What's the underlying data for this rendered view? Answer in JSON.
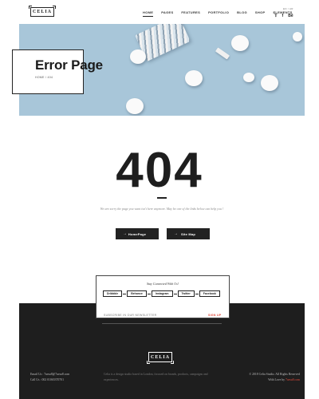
{
  "header": {
    "logo": "CELIA",
    "nav": [
      "HOME",
      "PAGES",
      "FEATURES",
      "PORTFOLIO",
      "BLOG",
      "SHOP",
      "ELEMENTS"
    ],
    "lang": "EN / AR",
    "social": [
      "twitter-icon",
      "facebook-icon",
      "behance-icon"
    ]
  },
  "hero": {
    "title": "Error Page",
    "breadcrumb": "HOME / 404"
  },
  "error": {
    "code": "404",
    "message": "We are sorry the page you want isn't here anymore. May be one of the links below can help you !",
    "buttons": [
      {
        "label": "HomePage",
        "icon": "arrow-right-icon"
      },
      {
        "label": "Site Map",
        "icon": "arrow-right-icon"
      }
    ]
  },
  "newsletter": {
    "title": "Stay Connected With Us!",
    "social_links": [
      "Dribbble",
      "Behance",
      "Instagram",
      "Twitter",
      "Facebook"
    ],
    "input_placeholder": "SUBSCRIBE IN OUR NEWSLETTER",
    "submit": "SIGN UP"
  },
  "footer": {
    "logo": "CELIA",
    "email": "Email Us : 7uesa8@7uesa8.com",
    "phone": "Call Us : 002 01065370701",
    "description": "Celia is a design studio based in London, focused on brands, products, campaigns and experiences.",
    "copyright": "© 2018 Celia Studio. All Rights Reserved",
    "credit_prefix": "With Love by ",
    "credit_name": "7uesa8.com"
  },
  "colors": {
    "accent": "#e14b3c",
    "dark": "#1e1e1e",
    "hero_bg": "#a8c6d9"
  }
}
